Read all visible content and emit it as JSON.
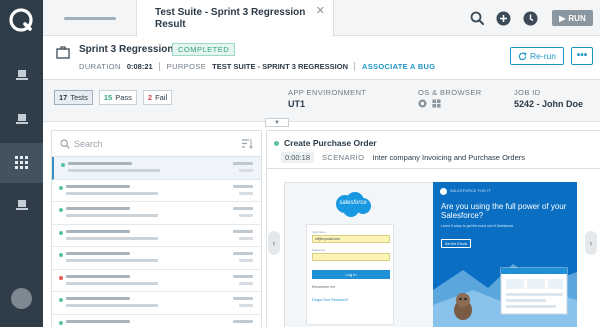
{
  "tab": {
    "title": "Test Suite - Sprint 3 Regression Result"
  },
  "toolbar": {
    "run_label": "RUN"
  },
  "header": {
    "suite_name": "Sprint 3 Regression",
    "status": "COMPLETED",
    "duration_label": "DURATION",
    "duration_value": "0:08:21",
    "purpose_label": "PURPOSE",
    "purpose_value": "TEST SUITE - SPRINT 3 REGRESSION",
    "associate_bug": "ASSOCIATE A BUG",
    "rerun_label": "Re-run"
  },
  "summary": {
    "counts": [
      {
        "num": "17",
        "label": "Tests"
      },
      {
        "num": "15",
        "label": "Pass"
      },
      {
        "num": "2",
        "label": "Fail"
      }
    ],
    "app_env_label": "APP ENVIRONMENT",
    "app_env_value": "UT1",
    "os_label": "OS & BROWSER",
    "job_label": "JOB ID",
    "job_value": "5242 - John Doe"
  },
  "list": {
    "search_placeholder": "Search",
    "status_colors": {
      "pass": "#5bbfa6",
      "fail": "#e05a4f"
    },
    "rows": [
      "pass",
      "pass",
      "pass",
      "pass",
      "pass",
      "fail",
      "pass",
      "pass"
    ]
  },
  "detail": {
    "title": "Create Purchase Order",
    "duration": "0:00:18",
    "scenario_label": "SCENARIO",
    "scenario_name": "Inter company Invoicing and Purchase Orders"
  },
  "preview": {
    "logo_text": "salesforce",
    "username_value": "sf@mymail.com",
    "login_button": "Log In",
    "remember": "Remember me",
    "forgot": "Forgot Your Password?",
    "promo_kicker": "SALESFORCE FOR IT",
    "promo_title": "Are you using the full power of your Salesforce?",
    "promo_sub": "Learn 5 ways to get the most out of Salesforce.",
    "promo_cta": "Get the Ebook"
  },
  "theme": {
    "accent": "#1f95c7",
    "rail": "#2f3d49",
    "pass": "#35a37f",
    "fail": "#d64545"
  }
}
